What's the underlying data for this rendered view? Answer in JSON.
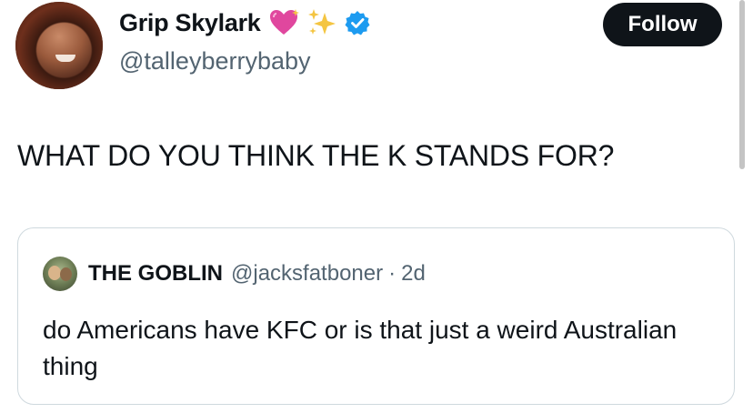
{
  "author": {
    "display_name": "Grip Skylark",
    "handle": "@talleyberrybaby",
    "name_emoji": [
      "sparkling-heart",
      "sparkles"
    ],
    "verified": true
  },
  "follow_label": "Follow",
  "tweet_text": "WHAT DO YOU THINK THE K STANDS FOR?",
  "quoted": {
    "display_name": "THE GOBLIN",
    "handle": "@jacksfatboner",
    "separator": "·",
    "time": "2d",
    "text": "do Americans have KFC or is that just a weird Australian thing"
  },
  "colors": {
    "follow_bg": "#0f1419",
    "verified_blue": "#1d9bf0",
    "secondary_text": "#536471",
    "heart_pink": "#e0479e",
    "sparkle_gold": "#f4c542"
  }
}
